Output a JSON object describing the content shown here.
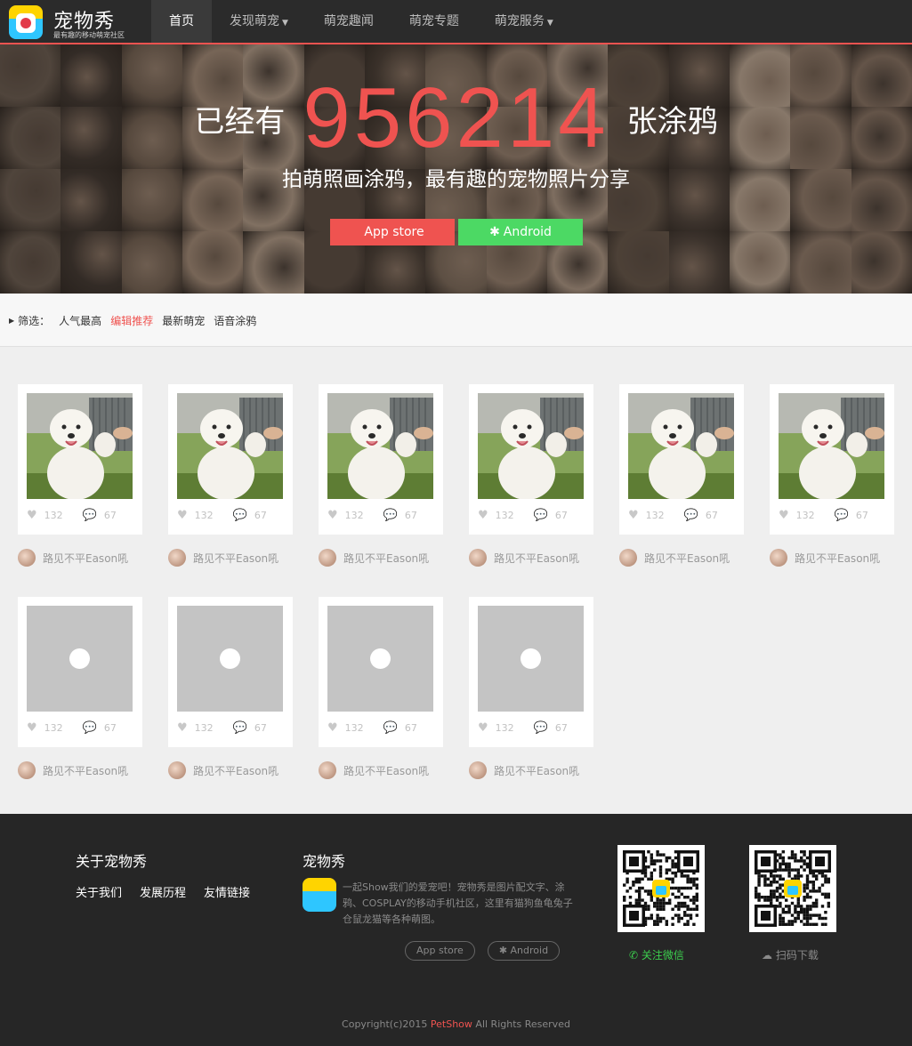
{
  "nav": {
    "logo_title": "宠物秀",
    "logo_sub": "最有趣的移动萌宠社区",
    "items": [
      {
        "label": "首页",
        "active": true,
        "caret": false
      },
      {
        "label": "发现萌宠",
        "active": false,
        "caret": true
      },
      {
        "label": "萌宠趣闻",
        "active": false,
        "caret": false
      },
      {
        "label": "萌宠专题",
        "active": false,
        "caret": false
      },
      {
        "label": "萌宠服务",
        "active": false,
        "caret": true
      }
    ]
  },
  "hero": {
    "prefix": "已经有",
    "count": "956214",
    "suffix": "张涂鸦",
    "tagline": "拍萌照画涂鸦，最有趣的宠物照片分享",
    "ios_label": "App store",
    "android_label": "Android"
  },
  "filter": {
    "label": "筛选：",
    "options": [
      {
        "label": "人气最高",
        "active": false
      },
      {
        "label": "编辑推荐",
        "active": true
      },
      {
        "label": "最新萌宠",
        "active": false
      },
      {
        "label": "语音涂鸦",
        "active": false
      }
    ]
  },
  "cards": [
    {
      "likes": "132",
      "comments": "67",
      "author": "路见不平Eason吼",
      "placeholder": false
    },
    {
      "likes": "132",
      "comments": "67",
      "author": "路见不平Eason吼",
      "placeholder": false
    },
    {
      "likes": "132",
      "comments": "67",
      "author": "路见不平Eason吼",
      "placeholder": false
    },
    {
      "likes": "132",
      "comments": "67",
      "author": "路见不平Eason吼",
      "placeholder": false
    },
    {
      "likes": "132",
      "comments": "67",
      "author": "路见不平Eason吼",
      "placeholder": false
    },
    {
      "likes": "132",
      "comments": "67",
      "author": "路见不平Eason吼",
      "placeholder": false
    },
    {
      "likes": "132",
      "comments": "67",
      "author": "路见不平Eason吼",
      "placeholder": true
    },
    {
      "likes": "132",
      "comments": "67",
      "author": "路见不平Eason吼",
      "placeholder": true
    },
    {
      "likes": "132",
      "comments": "67",
      "author": "路见不平Eason吼",
      "placeholder": true
    },
    {
      "likes": "132",
      "comments": "67",
      "author": "路见不平Eason吼",
      "placeholder": true
    }
  ],
  "footer": {
    "about_title": "关于宠物秀",
    "links": [
      "关于我们",
      "发展历程",
      "友情链接"
    ],
    "app_title": "宠物秀",
    "app_desc": "一起Show我们的爱宠吧！宠物秀是图片配文字、涂鸦、COSPLAY的移动手机社区，这里有猫狗鱼龟兔子仓鼠龙猫等各种萌图。",
    "app_btn_ios": "App store",
    "app_btn_android": "Android",
    "qr_wechat_label": "关注微信",
    "qr_download_label": "扫码下载",
    "copyright_pre": "Copyright(c)2015 ",
    "copyright_brand": "PetShow",
    "copyright_post": " All Rights Reserved"
  },
  "colors": {
    "accent": "#ef5350",
    "android_green": "#4cd964",
    "nav_bg": "#2b2b2b",
    "footer_bg": "#262626",
    "wechat_green": "#3ccf4e"
  }
}
